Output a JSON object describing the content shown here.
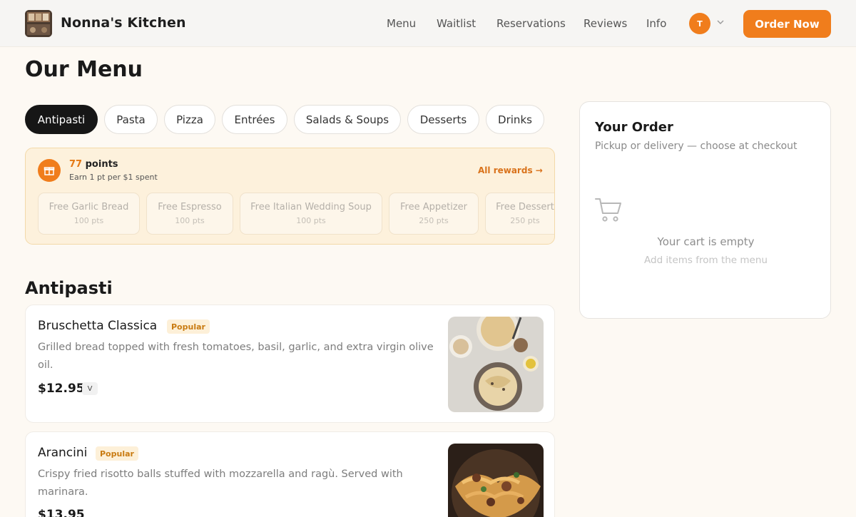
{
  "header": {
    "brand": "Nonna's Kitchen",
    "nav": [
      "Menu",
      "Waitlist",
      "Reservations",
      "Reviews",
      "Info"
    ],
    "avatar_initial": "T",
    "cta_label": "Order Now",
    "accent_color": "#f07d1c"
  },
  "page": {
    "title": "Our Menu"
  },
  "tabs": [
    {
      "label": "Antipasti",
      "active": true
    },
    {
      "label": "Pasta",
      "active": false
    },
    {
      "label": "Pizza",
      "active": false
    },
    {
      "label": "Entrées",
      "active": false
    },
    {
      "label": "Salads & Soups",
      "active": false
    },
    {
      "label": "Desserts",
      "active": false
    },
    {
      "label": "Drinks",
      "active": false
    }
  ],
  "rewards": {
    "points_value": "77",
    "points_label": "points",
    "earn_text": "Earn 1 pt per $1 spent",
    "all_rewards_label": "All rewards",
    "items": [
      {
        "name": "Free Garlic Bread",
        "pts": "100 pts"
      },
      {
        "name": "Free Espresso",
        "pts": "100 pts"
      },
      {
        "name": "Free Italian Wedding Soup",
        "pts": "100 pts"
      },
      {
        "name": "Free Appetizer",
        "pts": "250 pts"
      },
      {
        "name": "Free Dessert",
        "pts": "250 pts"
      }
    ]
  },
  "section": {
    "title": "Antipasti",
    "items": [
      {
        "name": "Bruschetta Classica",
        "badge": "Popular",
        "description": "Grilled bread topped with fresh tomatoes, basil, garlic, and extra virgin olive oil.",
        "price": "$12.95",
        "diet_tag": "V"
      },
      {
        "name": "Arancini",
        "badge": "Popular",
        "description": "Crispy fried risotto balls stuffed with mozzarella and ragù. Served with marinara.",
        "price": "$13.95"
      }
    ]
  },
  "order": {
    "title": "Your Order",
    "subtitle": "Pickup or delivery — choose at checkout",
    "empty_title": "Your cart is empty",
    "empty_subtitle": "Add items from the menu"
  }
}
